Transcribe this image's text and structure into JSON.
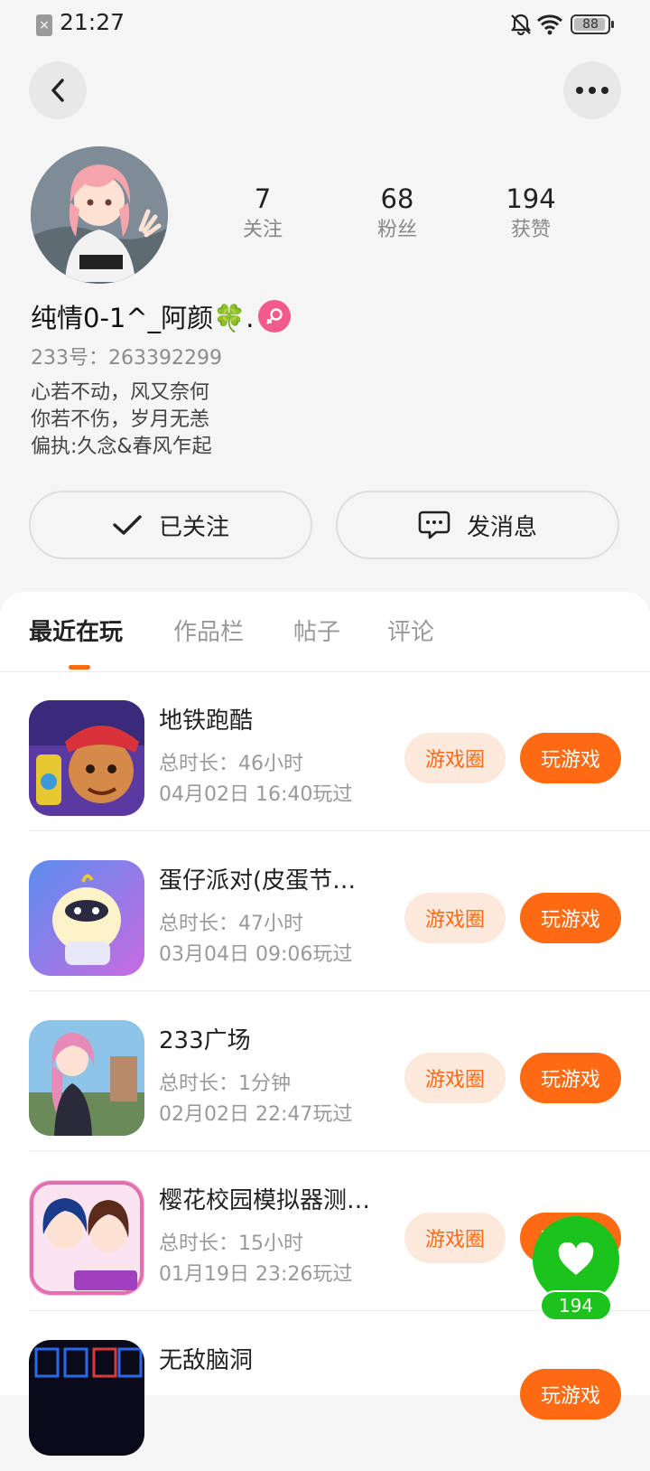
{
  "status_bar": {
    "time": "21:27",
    "battery": "88"
  },
  "profile": {
    "stats": [
      {
        "value": "7",
        "label": "关注"
      },
      {
        "value": "68",
        "label": "粉丝"
      },
      {
        "value": "194",
        "label": "获赞"
      }
    ],
    "nickname": "纯情0-1^_阿颜🍀.",
    "user_id": "233号：263392299",
    "bio": [
      "心若不动，风又奈何",
      "你若不伤，岁月无恙",
      "偏执:久念&春风乍起"
    ]
  },
  "actions": {
    "follow_label": "已关注",
    "message_label": "发消息"
  },
  "tabs": [
    "最近在玩",
    "作品栏",
    "帖子",
    "评论"
  ],
  "games": [
    {
      "title": "地铁跑酷",
      "time": "总时长：46小时",
      "last": "04月02日 16:40玩过",
      "circle": "游戏圈",
      "play": "玩游戏"
    },
    {
      "title": "蛋仔派对(皮蛋节…",
      "time": "总时长：47小时",
      "last": "03月04日 09:06玩过",
      "circle": "游戏圈",
      "play": "玩游戏"
    },
    {
      "title": "233广场",
      "time": "总时长：1分钟",
      "last": "02月02日 22:47玩过",
      "circle": "游戏圈",
      "play": "玩游戏"
    },
    {
      "title": "樱花校园模拟器测…",
      "time": "总时长：15小时",
      "last": "01月19日 23:26玩过",
      "circle": "游戏圈",
      "play": "玩游戏"
    },
    {
      "title": "无敌脑洞",
      "time": "",
      "last": "",
      "circle": "",
      "play": "玩游戏"
    }
  ],
  "like_fab": {
    "count": "194"
  },
  "colors": {
    "accent": "#ff6a13",
    "accent_light": "#fde8dc",
    "like_green": "#1dc31d",
    "gender_pink": "#f25a8e"
  }
}
